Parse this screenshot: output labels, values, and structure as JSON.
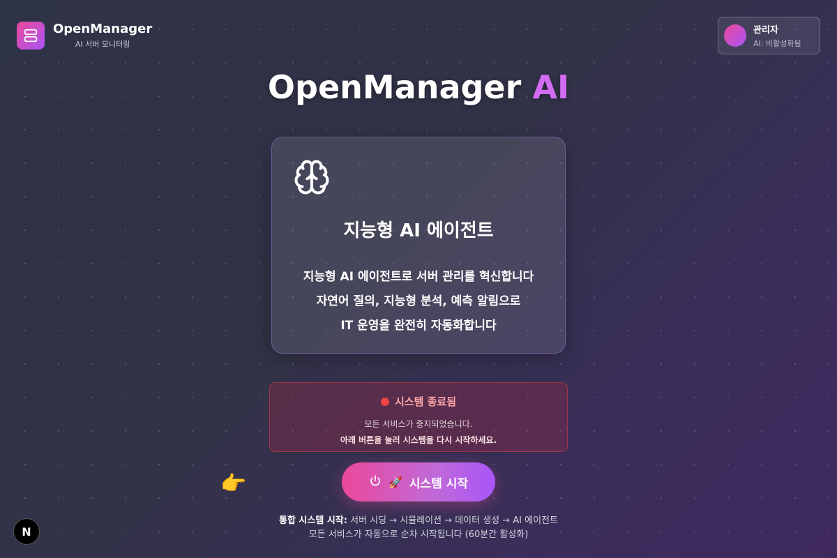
{
  "header": {
    "app_name": "OpenManager",
    "app_subtitle": "AI 서버 모니터링",
    "logo_icon": "server-icon"
  },
  "profile": {
    "name": "관리자",
    "status": "AI: 비활성화됨"
  },
  "hero": {
    "title_main": "OpenManager",
    "title_accent": "AI",
    "accent_color": "#d16cf2"
  },
  "feature_card": {
    "icon": "brain-icon",
    "title": "지능형 AI 에이전트",
    "description": [
      "지능형 AI 에이전트로 서버 관리를 혁신합니다",
      "자연어 질의, 지능형 분석, 예측 알림으로",
      "IT 운영을 완전히 자동화합니다"
    ]
  },
  "system_status": {
    "title": "시스템 종료됨",
    "status_color": "#ef4444",
    "line1": "모든 서비스가 중지되었습니다.",
    "line2": "아래 버튼을 눌러 시스템을 다시 시작하세요."
  },
  "start_button": {
    "label": "시스템 시작",
    "icon": "power-icon",
    "emoji": "🚀"
  },
  "pointer_emoji": "👉",
  "footer": {
    "label": "통합 시스템 시작:",
    "steps": "서버 시딩 → 시뮬레이션 → 데이터 생성 → AI 에이전트",
    "line2": "모든 서비스가 자동으로 순차 시작됩니다 (60분간 활성화)"
  },
  "dev_badge": "N"
}
